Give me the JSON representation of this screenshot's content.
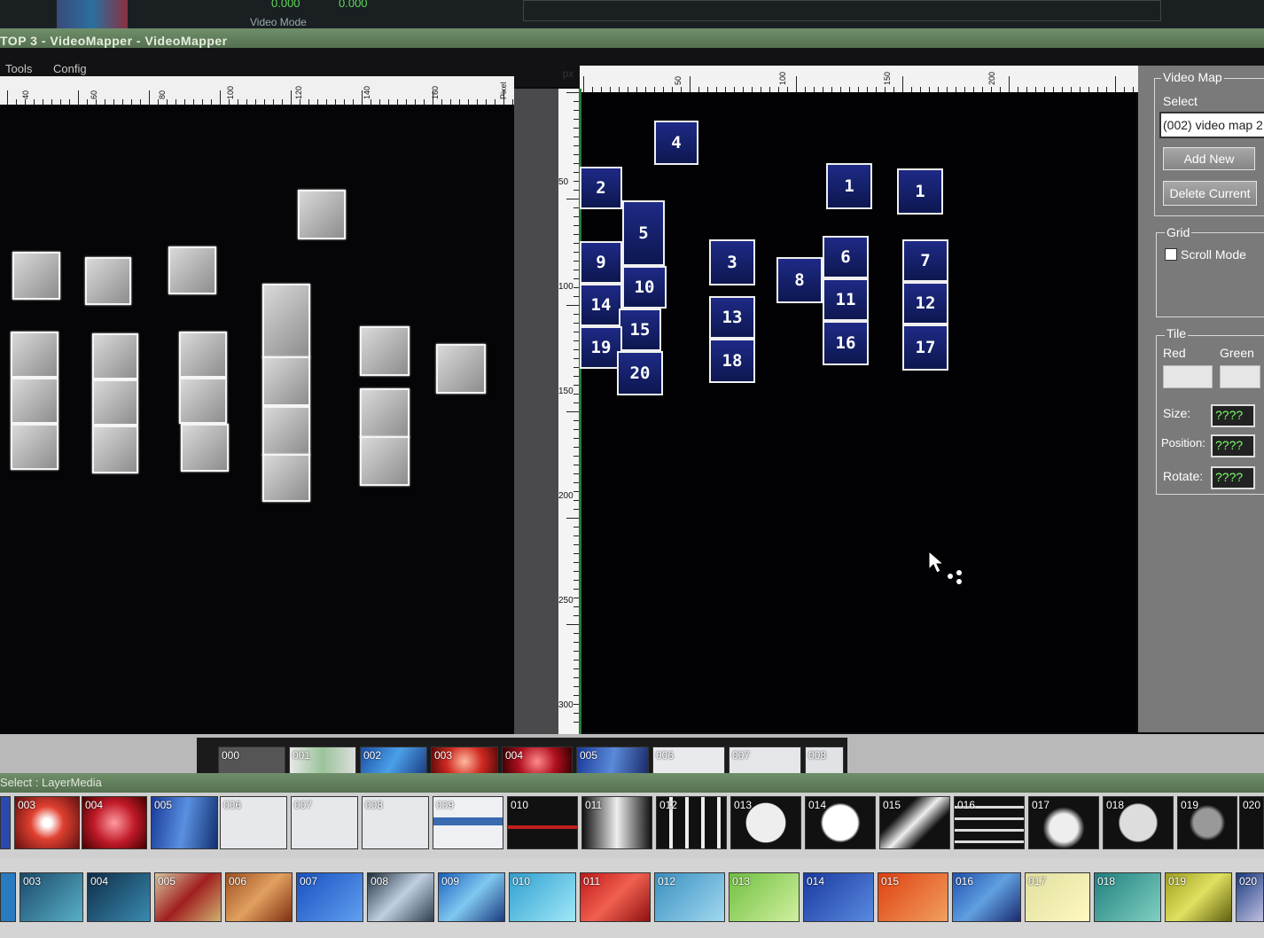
{
  "window": {
    "title": "TOP 3 - VideoMapper - VideoMapper"
  },
  "top_readouts": [
    "0.000",
    "0.000",
    "Video Mode"
  ],
  "menu": {
    "items": [
      "Tools",
      "Config"
    ]
  },
  "ruler_left": {
    "labels": [
      "40",
      "60",
      "80",
      "100",
      "120",
      "140",
      "160",
      "Pixel"
    ]
  },
  "ruler_right": {
    "unit": "px",
    "top_labels": [
      "50",
      "100",
      "150",
      "200"
    ],
    "side_labels": [
      "50",
      "100",
      "150",
      "200",
      "250",
      "300"
    ]
  },
  "tiles": [
    "4",
    "2",
    "5",
    "9",
    "10",
    "14",
    "15",
    "19",
    "20",
    "3",
    "13",
    "18",
    "8",
    "1",
    "6",
    "11",
    "16",
    "1",
    "7",
    "12",
    "17"
  ],
  "panel": {
    "video_map": {
      "legend": "Video Map",
      "select_label": "Select",
      "select_value": "(002) video map 2",
      "add_new": "Add New",
      "delete_current": "Delete Current"
    },
    "grid": {
      "legend": "Grid",
      "scroll_mode": "Scroll Mode",
      "scroll_mode_checked": false
    },
    "tile": {
      "legend": "Tile",
      "red": "Red",
      "green": "Green",
      "size_label": "Size:",
      "size_value": "????",
      "position_label": "Position:",
      "position_value": "????",
      "rotate_label": "Rotate:",
      "rotate_value": "????"
    }
  },
  "status_bar": {
    "text": "Select : LayerMedia"
  },
  "strip1": [
    "000",
    "001",
    "002",
    "003",
    "004",
    "005",
    "006",
    "007",
    "008"
  ],
  "strip2": [
    "003",
    "004",
    "005",
    "006",
    "007",
    "008",
    "009",
    "010",
    "011",
    "012",
    "013",
    "014",
    "015",
    "016",
    "017",
    "018",
    "019",
    "020"
  ],
  "strip3": [
    "003",
    "004",
    "005",
    "006",
    "007",
    "008",
    "009",
    "010",
    "011",
    "012",
    "013",
    "014",
    "015",
    "016",
    "017",
    "018",
    "019",
    "020"
  ],
  "colors": {
    "title_bar": "#5f7e59",
    "tile_blue": "#1a2680",
    "panel_grey": "#7a7a7a",
    "field_text": "#7cff6a",
    "ruler_accent": "#2f7a3c"
  }
}
